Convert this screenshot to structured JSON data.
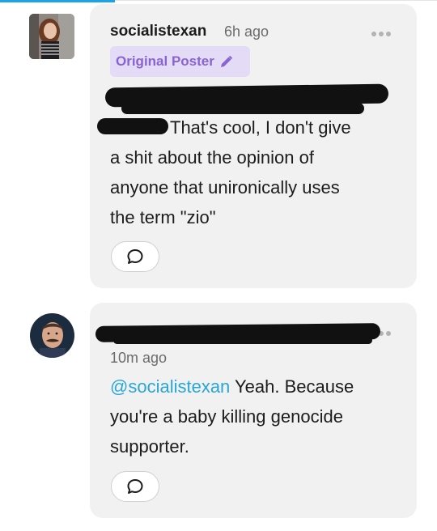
{
  "comments": [
    {
      "username": "socialistexan",
      "timestamp": "6h ago",
      "badge": "Original Poster",
      "text_after_redaction": "That's cool, I don't give",
      "text_lines": [
        "a shit about the opinion of",
        "anyone that unironically uses",
        "the term \"zio\""
      ]
    },
    {
      "username": "",
      "timestamp": "10m ago",
      "mention": "@socialistexan",
      "text_first": " Yeah. Because",
      "text_lines": [
        "you're a baby killing genocide",
        "supporter."
      ]
    }
  ],
  "icons": {
    "more": "more-horizontal-icon",
    "edit": "pencil-icon",
    "reply": "speech-bubble-icon"
  },
  "colors": {
    "card_bg": "#f1f1f1",
    "badge_bg": "#e4dcf7",
    "badge_text": "#8a63d2",
    "mention": "#29a6d8",
    "progress": "#1aa3e8"
  }
}
